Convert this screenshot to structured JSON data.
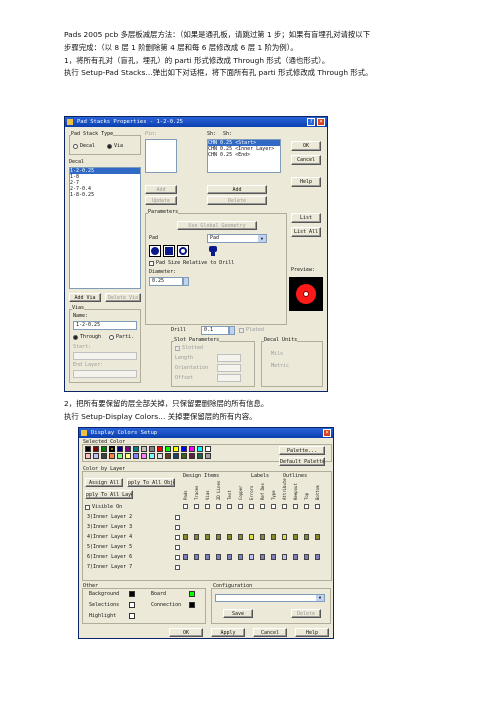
{
  "doc": {
    "p1_l1": "Pads 2005 pcb  多层板减层方法：（如果是通孔板，请跳过第 1 步；如果有盲埋孔对请按以下",
    "p1_l2": "步骤完成：（以 8 层 1 阶删除第 4 层和每 6 层修改成 6 层 1 阶为例）。",
    "p1_l3": "1，将所有孔对（盲孔，埋孔）的 parti 形式修改成 Through 形式（通也形式）。",
    "p1_l4": "    执行 Setup-Pad Stacks…弹出如下对话框，将下面所有孔 parti 形式修改成 Through  形式。",
    "p2_l1": "2，把所有要保留的层全部关掉，只保留要删除层的所有信息。",
    "p2_l2": "执行 Setup-Display Colors…  关掉要保留层的所有内容。"
  },
  "padstack": {
    "title": "Pad Stacks Properties - 1-2-0.25",
    "type_label": "Pad Stack Type",
    "decal": "Decal",
    "via": "Via",
    "decal_list_label": "Decal",
    "decal_items": [
      "1-2-0.25",
      "1-8",
      "2-7",
      "2-7-0.4",
      "1-8-0.25"
    ],
    "pin_label": "Pin:",
    "sh_label": "Sh:",
    "sh2_label": "Sh:",
    "shapes": [
      "CHN 0.25 <Start>",
      "CHN 0.25 <Inner Layer>",
      "CHN 0.25 <End>"
    ],
    "ok": "OK",
    "cancel": "Cancel",
    "help": "Help",
    "add": "Add",
    "update": "Update",
    "add2": "Add",
    "delete": "Delete",
    "list": "List",
    "list_all": "List All",
    "params_label": "Parameters",
    "use_global": "Use Global Geometry",
    "pad_label": "Pad",
    "pad_value": "Pad",
    "pad_size_rel": "Pad Size Relative to Drill",
    "diameter_label": "Diameter:",
    "diameter_value": "0.25",
    "preview_label": "Preview:",
    "add_via": "Add Via",
    "delete_via": "Delete Via",
    "vias_label": "Vias",
    "name_label": "Name:",
    "name_value": "1-2-0.25",
    "through": "Through",
    "partial": "Parti.",
    "start_label": "Start:",
    "end_layer_label": "End Layer:",
    "drill_label": "Drill",
    "drill_value": "0.1",
    "plated": "Plated",
    "slot_params": "Slot Parameters",
    "slotted": "Slotted",
    "length": "Length",
    "orientation": "Orientation",
    "offset": "Offset",
    "decal_units": "Decal Units",
    "mils": "Mils",
    "metric": "Metric"
  },
  "colors": {
    "title": "Display Colors Setup",
    "selected_color": "Selected Color",
    "palette": "Palette...",
    "default_palette": "Default Palette",
    "color_by_layer": "Color by Layer",
    "assign_all": "Assign All",
    "apply_all_objects": "pply To All Objec",
    "apply_all_layers": "pply To All Layer",
    "visible_on": "Visible On",
    "design_items": "Design Items",
    "labels": "Labels",
    "outlines": "Outlines",
    "columns": [
      "Pads",
      "Traces",
      "Vias",
      "2D Lines",
      "Text",
      "Copper",
      "Errors",
      "Ref Des",
      "Type",
      "Attribute",
      "Keepout",
      "Top",
      "Bottom"
    ],
    "layers": [
      "3)Inner Layer 2",
      "3)Inner Layer 3",
      "4)Inner Layer 4",
      "5)Inner Layer 5",
      "6)Inner Layer 6",
      "7)Inner Layer 7"
    ],
    "other": "Other",
    "background": "Background",
    "board": "Board",
    "selections": "Selections",
    "connection": "Connection",
    "highlight": "Highlight",
    "configuration": "Configuration",
    "save": "Save",
    "delete": "Delete",
    "ok": "OK",
    "apply": "Apply",
    "cancel": "Cancel",
    "help": "Help",
    "palette_colors": [
      "#000000",
      "#800000",
      "#008000",
      "#808000",
      "#000080",
      "#800080",
      "#008080",
      "#c0c0c0",
      "#808080",
      "#ff0000",
      "#00ff00",
      "#ffff00",
      "#0000ff",
      "#ff00ff",
      "#00ffff",
      "#ffffff",
      "#ffc0c0",
      "#c0c0ff",
      "#404040",
      "#ff8040",
      "#80ff80",
      "#ffff80",
      "#8080ff",
      "#ff80ff",
      "#80ffff",
      "#e0e0e0",
      "#604020",
      "#204060",
      "#406020",
      "#602040",
      "#206040",
      "#a0a0a0"
    ],
    "row_colors": {
      "layer4": "#8a8a2a",
      "layer6": "#8080c0",
      "layer4_hi": "#e0e040",
      "layer6_hi": "#c0c0ff"
    }
  }
}
